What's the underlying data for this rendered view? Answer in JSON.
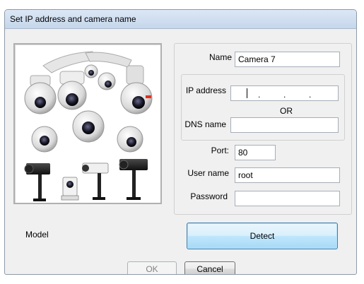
{
  "window": {
    "title": "Set IP address and camera name"
  },
  "form": {
    "name_label": "Name",
    "name_value": "Camera 7",
    "ip_label": "IP address",
    "ip_value": "   .   .   .",
    "or_label": "OR",
    "dns_label": "DNS name",
    "dns_value": "",
    "port_label": "Port:",
    "port_value": "80",
    "username_label": "User name",
    "username_value": "root",
    "password_label": "Password",
    "password_value": ""
  },
  "model": {
    "label": "Model"
  },
  "buttons": {
    "detect": "Detect",
    "ok": "OK",
    "cancel": "Cancel"
  },
  "image": {
    "icon": "camera-collection-image"
  }
}
